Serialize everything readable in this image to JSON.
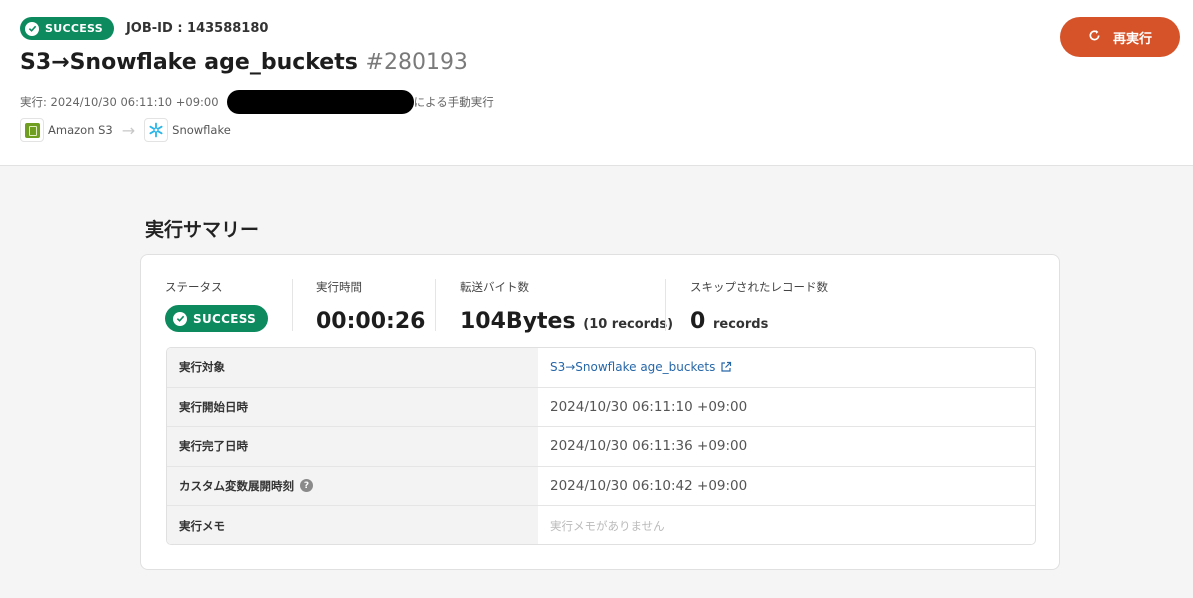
{
  "header": {
    "status": "SUCCESS",
    "job_id": "JOB-ID : 143588180",
    "title": "S3→Snowflake age_buckets",
    "run_number": "#280193",
    "executed_prefix": "実行: 2024/10/30 06:11:10 +09:00",
    "executed_suffix": "による手動実行",
    "source_name": "Amazon S3",
    "destination_name": "Snowflake",
    "rerun_label": "再実行"
  },
  "summary": {
    "title": "実行サマリー",
    "status_label": "ステータス",
    "status_value": "SUCCESS",
    "duration_label": "実行時間",
    "duration_value": "00:00:26",
    "bytes_label": "転送バイト数",
    "bytes_value": "104Bytes",
    "bytes_records": "(10 records)",
    "skipped_label": "スキップされたレコード数",
    "skipped_value": "0",
    "skipped_unit": "records"
  },
  "details": {
    "target_label": "実行対象",
    "target_value": "S3→Snowflake age_buckets",
    "start_label": "実行開始日時",
    "start_value": "2024/10/30 06:11:10 +09:00",
    "end_label": "実行完了日時",
    "end_value": "2024/10/30 06:11:36 +09:00",
    "custom_label": "カスタム変数展開時刻",
    "custom_value": "2024/10/30 06:10:42 +09:00",
    "memo_label": "実行メモ",
    "memo_placeholder": "実行メモがありません"
  },
  "colors": {
    "success": "#0e8a5f",
    "rerun": "#d6532a",
    "link": "#2767a8"
  }
}
